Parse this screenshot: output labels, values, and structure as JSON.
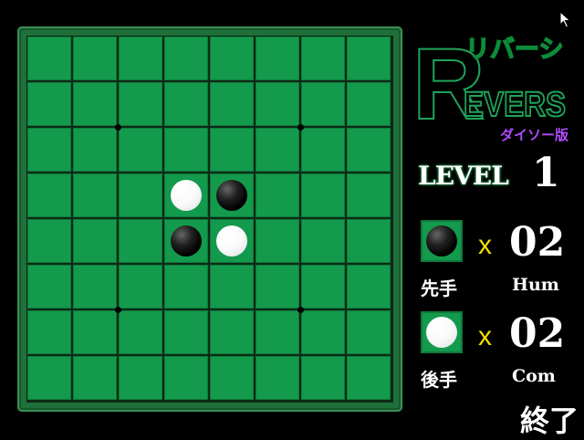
{
  "logo": {
    "kana": "リバーシ",
    "title_a": "R",
    "title_b": "EVERS",
    "sub": "ダイソー版"
  },
  "level": {
    "label": "LEVEL",
    "value": "1"
  },
  "players": [
    {
      "stone": "black",
      "times": "x",
      "count": "02",
      "side": "先手",
      "name": "Hum"
    },
    {
      "stone": "white",
      "times": "x",
      "count": "02",
      "side": "後手",
      "name": "Com"
    }
  ],
  "board": {
    "size": 8,
    "stones": [
      {
        "row": 3,
        "col": 3,
        "color": "white"
      },
      {
        "row": 3,
        "col": 4,
        "color": "black"
      },
      {
        "row": 4,
        "col": 3,
        "color": "black"
      },
      {
        "row": 4,
        "col": 4,
        "color": "white"
      }
    ],
    "star_points": [
      [
        2,
        2
      ],
      [
        2,
        6
      ],
      [
        6,
        2
      ],
      [
        6,
        6
      ]
    ]
  },
  "end_button": "終了",
  "colors": {
    "board_green": "#139a4c",
    "accent_yellow": "#f0e000",
    "logo_green": "#1ea45a"
  }
}
